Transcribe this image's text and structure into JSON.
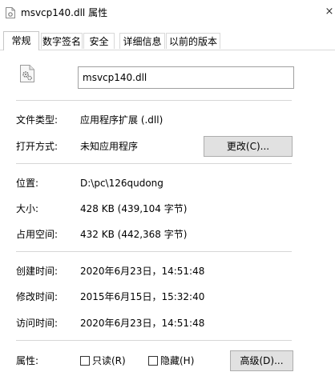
{
  "window": {
    "title": "msvcp140.dll 属性",
    "close_glyph": "×"
  },
  "tabs": [
    {
      "label": "常规",
      "active": true
    },
    {
      "label": "数字签名",
      "active": false
    },
    {
      "label": "安全",
      "active": false
    },
    {
      "label": "详细信息",
      "active": false
    },
    {
      "label": "以前的版本",
      "active": false
    }
  ],
  "general": {
    "filename": "msvcp140.dll",
    "file_type": {
      "label": "文件类型:",
      "value": "应用程序扩展 (.dll)"
    },
    "opens_with": {
      "label": "打开方式:",
      "value": "未知应用程序",
      "change_button": "更改(C)..."
    },
    "location": {
      "label": "位置:",
      "value": "D:\\pc\\126qudong"
    },
    "size": {
      "label": "大小:",
      "value": "428 KB (439,104 字节)"
    },
    "size_on_disk": {
      "label": "占用空间:",
      "value": "432 KB (442,368 字节)"
    },
    "created": {
      "label": "创建时间:",
      "value": "2020年6月23日，14:51:48"
    },
    "modified": {
      "label": "修改时间:",
      "value": "2015年6月15日，15:32:40"
    },
    "accessed": {
      "label": "访问时间:",
      "value": "2020年6月23日，14:51:48"
    },
    "attributes": {
      "label": "属性:",
      "readonly": {
        "label": "只读(R)",
        "checked": false
      },
      "hidden": {
        "label": "隐藏(H)",
        "checked": false
      },
      "advanced_button": "高级(D)..."
    }
  },
  "icons": {
    "title": "dll-file-icon",
    "file": "dll-gear-file-icon"
  },
  "colors": {
    "button_face": "#e1e1e1",
    "button_border": "#adadad",
    "separator": "#d6d6d6",
    "input_border": "#a0a0a0"
  }
}
